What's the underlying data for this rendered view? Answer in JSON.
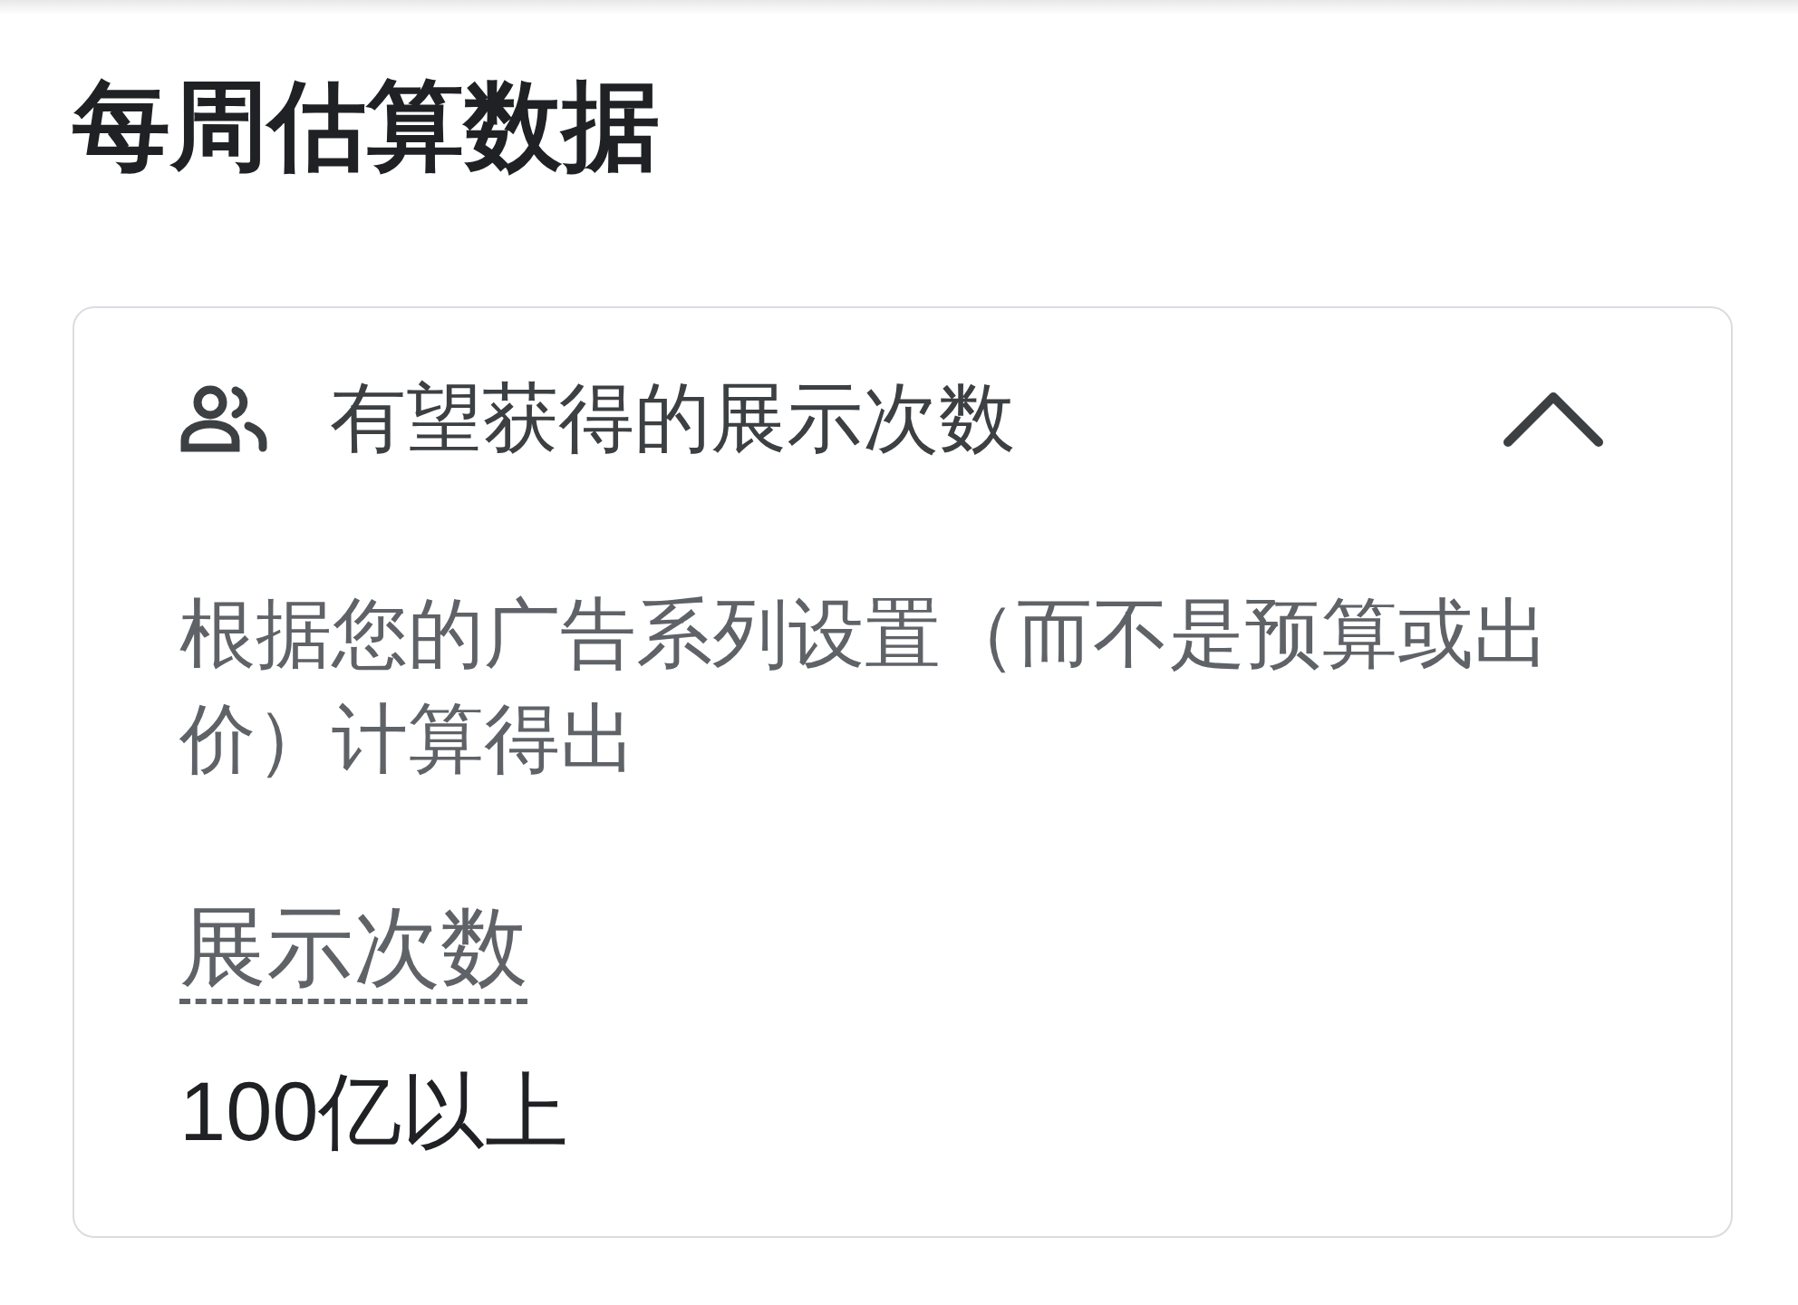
{
  "title": "每周估算数据",
  "panel": {
    "title": "有望获得的展示次数",
    "expanded": true,
    "description": "根据您的广告系列设置（而不是预算或出价）计算得出",
    "metric": {
      "label": "展示次数",
      "value": "100亿以上"
    }
  }
}
